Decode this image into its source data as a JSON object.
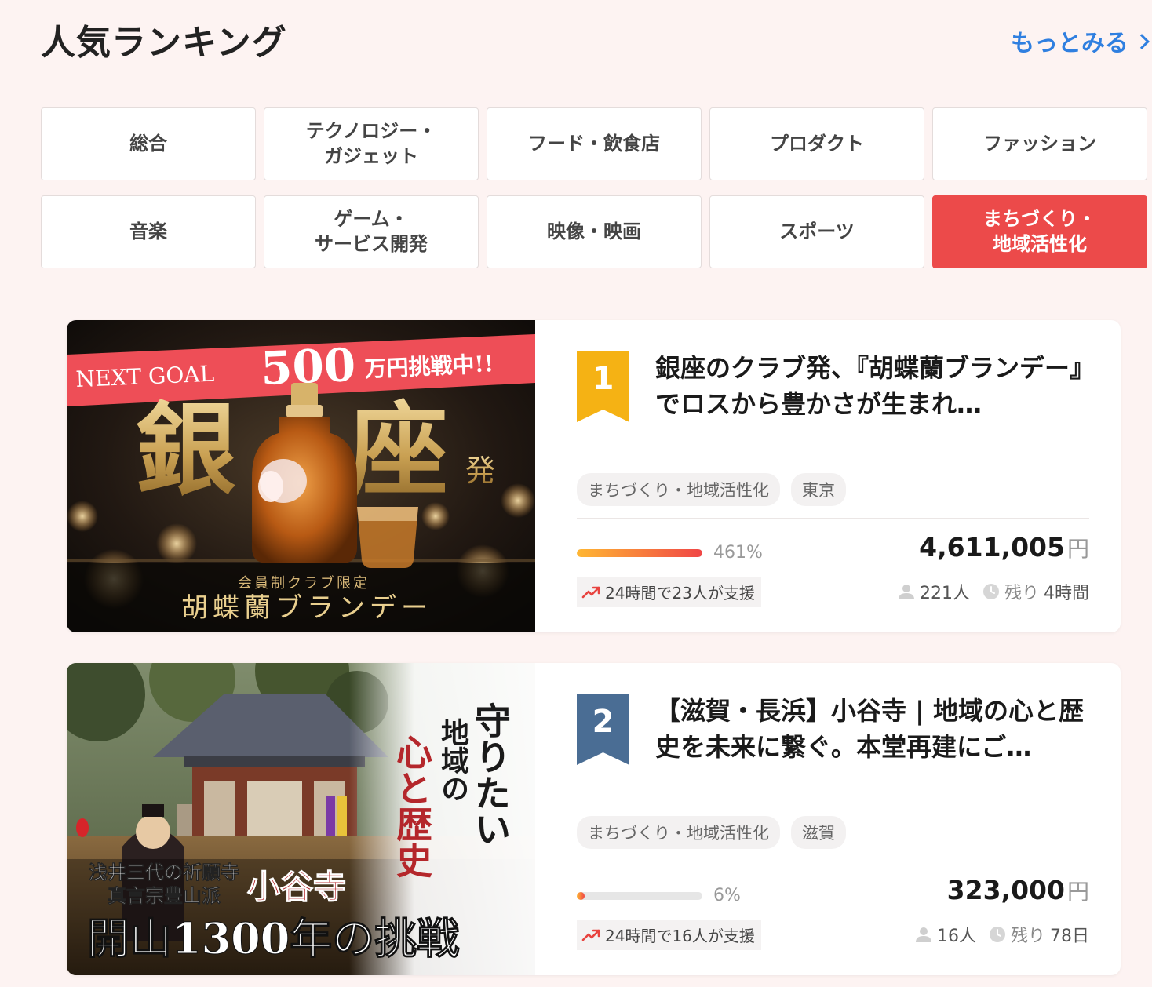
{
  "header": {
    "title": "人気ランキング",
    "more_label": "もっとみる"
  },
  "tabs": [
    {
      "label": "総合",
      "active": false
    },
    {
      "label": "テクノロジー・\nガジェット",
      "active": false
    },
    {
      "label": "フード・飲食店",
      "active": false
    },
    {
      "label": "プロダクト",
      "active": false
    },
    {
      "label": "ファッション",
      "active": false
    },
    {
      "label": "音楽",
      "active": false
    },
    {
      "label": "ゲーム・\nサービス開発",
      "active": false
    },
    {
      "label": "映像・映画",
      "active": false
    },
    {
      "label": "スポーツ",
      "active": false
    },
    {
      "label": "まちづくり・\n地域活性化",
      "active": true
    }
  ],
  "projects": [
    {
      "rank": "1",
      "rank_color": "#f5b214",
      "title": "銀座のクラブ発、『胡蝶蘭ブランデー』でロスから豊かさが生まれ…",
      "tags": [
        "まちづくり・地域活性化",
        "東京"
      ],
      "progress_fraction": 1.0,
      "percent": "461%",
      "amount": "4,611,005",
      "currency": "円",
      "trend": "24時間で23人が支援",
      "supporters": "221人",
      "remaining_label": "残り",
      "remaining": "4時間",
      "image": {
        "banner": "NEXT GOAL",
        "banner_big": "500",
        "banner_rest": "万円挑戦中!!",
        "big_left": "銀",
        "big_right": "座",
        "small": "発",
        "sub": "会員制クラブ限定",
        "product": "胡蝶蘭ブランデー"
      }
    },
    {
      "rank": "2",
      "rank_color": "#4a6d94",
      "title": "【滋賀・長浜】小谷寺 | 地域の心と歴史を未来に繋ぐ。本堂再建にご…",
      "tags": [
        "まちづくり・地域活性化",
        "滋賀"
      ],
      "progress_fraction": 0.06,
      "percent": "6%",
      "amount": "323,000",
      "currency": "円",
      "trend": "24時間で16人が支援",
      "supporters": "16人",
      "remaining_label": "残り",
      "remaining": "78日",
      "image": {
        "col1": "守りたい",
        "col2": "地域の",
        "col3": "心と歴史",
        "line1": "浅井三代の祈願寺",
        "line2": "真言宗豊山派",
        "temple": "小谷寺",
        "bottom": "開山1300年の挑戦"
      }
    }
  ]
}
